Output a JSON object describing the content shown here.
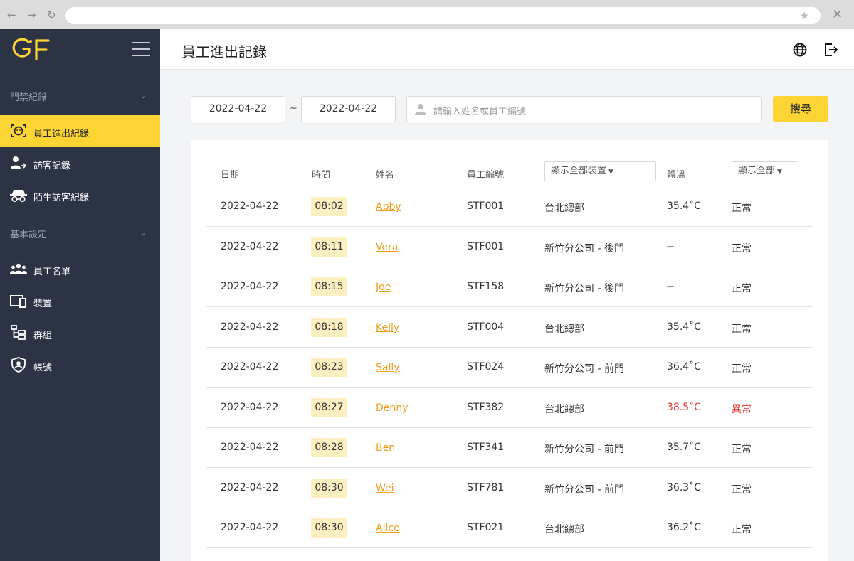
{
  "app": {
    "logo_text": "GF",
    "page_title": "員工進出記錄"
  },
  "colors": {
    "accent": "#fcd535",
    "sidebar_bg": "#2c3344",
    "link": "#f29b1b",
    "abnormal": "#e53935"
  },
  "sidebar": {
    "sections": [
      {
        "title": "門禁紀錄",
        "items": [
          {
            "label": "員工進出紀錄",
            "icon": "face-scan-icon",
            "active": true
          },
          {
            "label": "訪客記錄",
            "icon": "visitor-icon",
            "active": false
          },
          {
            "label": "陌生訪客紀錄",
            "icon": "incognito-icon",
            "active": false
          }
        ]
      },
      {
        "title": "基本設定",
        "items": [
          {
            "label": "員工名單",
            "icon": "people-icon",
            "active": false
          },
          {
            "label": "裝置",
            "icon": "devices-icon",
            "active": false
          },
          {
            "label": "群組",
            "icon": "hierarchy-icon",
            "active": false
          },
          {
            "label": "帳號",
            "icon": "shield-user-icon",
            "active": false
          }
        ]
      }
    ]
  },
  "search": {
    "date_from": "2022-04-22",
    "separator": "~",
    "date_to": "2022-04-22",
    "placeholder": "請輸入姓名或員工編號",
    "button_label": "搜尋"
  },
  "table": {
    "headers": {
      "date": "日期",
      "time": "時間",
      "name": "姓名",
      "employee_id": "員工編號",
      "device_filter": "顯示全部裝置",
      "temperature": "體溫",
      "status_filter": "顯示全部"
    },
    "rows": [
      {
        "date": "2022-04-22",
        "time": "08:02",
        "name": "Abby",
        "id": "STF001",
        "device": "台北總部",
        "temp": "35.4˚C",
        "status": "正常",
        "abnormal": false
      },
      {
        "date": "2022-04-22",
        "time": "08:11",
        "name": "Vera",
        "id": "STF001",
        "device": "新竹分公司 - 後門",
        "temp": "--",
        "status": "正常",
        "abnormal": false
      },
      {
        "date": "2022-04-22",
        "time": "08:15",
        "name": "Joe",
        "id": "STF158",
        "device": "新竹分公司 - 後門",
        "temp": "--",
        "status": "正常",
        "abnormal": false
      },
      {
        "date": "2022-04-22",
        "time": "08:18",
        "name": "Kelly",
        "id": "STF004",
        "device": "台北總部",
        "temp": "35.4˚C",
        "status": "正常",
        "abnormal": false
      },
      {
        "date": "2022-04-22",
        "time": "08:23",
        "name": "Sally",
        "id": "STF024",
        "device": "新竹分公司 - 前門",
        "temp": "36.4˚C",
        "status": "正常",
        "abnormal": false
      },
      {
        "date": "2022-04-22",
        "time": "08:27",
        "name": "Denny",
        "id": "STF382",
        "device": "台北總部",
        "temp": "38.5˚C",
        "status": "異常",
        "abnormal": true
      },
      {
        "date": "2022-04-22",
        "time": "08:28",
        "name": "Ben",
        "id": "STF341",
        "device": "新竹分公司 - 前門",
        "temp": "35.7˚C",
        "status": "正常",
        "abnormal": false
      },
      {
        "date": "2022-04-22",
        "time": "08:30",
        "name": "Wei",
        "id": "STF781",
        "device": "新竹分公司 - 前門",
        "temp": "36.3˚C",
        "status": "正常",
        "abnormal": false
      },
      {
        "date": "2022-04-22",
        "time": "08:30",
        "name": "Alice",
        "id": "STF021",
        "device": "台北總部",
        "temp": "36.2˚C",
        "status": "正常",
        "abnormal": false
      }
    ]
  }
}
